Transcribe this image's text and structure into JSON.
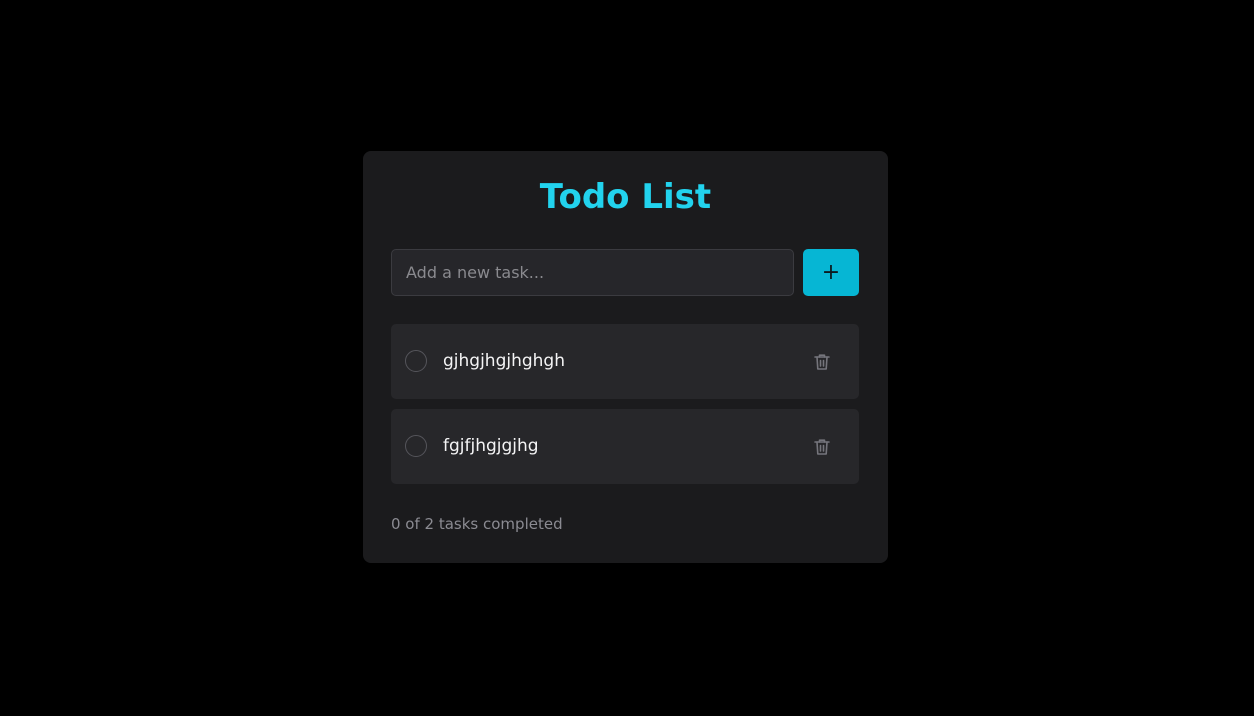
{
  "app": {
    "title": "Todo List"
  },
  "input": {
    "placeholder": "Add a new task...",
    "value": ""
  },
  "add_button": {
    "label": "+"
  },
  "tasks": [
    {
      "text": "gjhgjhgjhghgh",
      "completed": false
    },
    {
      "text": "fgjfjhgjgjhg",
      "completed": false
    }
  ],
  "footer": {
    "status": "0 of 2 tasks completed"
  },
  "icons": {
    "checkbox": "circle-checkbox-icon",
    "delete": "trash-icon"
  },
  "colors": {
    "accent": "#22d3ee",
    "button": "#06b6d4",
    "card": "#1b1b1d",
    "item": "#27272a",
    "background": "#000000"
  }
}
